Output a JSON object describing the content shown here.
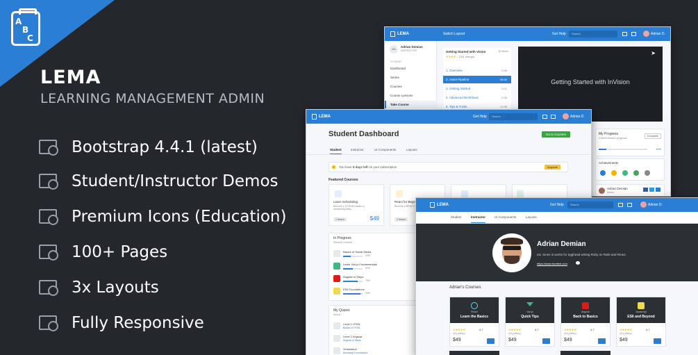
{
  "brand": {
    "logo_letters": [
      "A",
      "B",
      "C"
    ],
    "name": "LEMA",
    "tagline": "LEARNING MANAGEMENT ADMIN"
  },
  "features": [
    {
      "label": "Bootstrap 4.4.1 (latest)",
      "icon": "book-search-icon"
    },
    {
      "label": "Student/Instructor Demos",
      "icon": "book-search-icon"
    },
    {
      "label": "Premium Icons (Education)",
      "icon": "book-search-icon"
    },
    {
      "label": "100+ Pages",
      "icon": "book-search-icon"
    },
    {
      "label": "3x Layouts",
      "icon": "book-search-icon"
    },
    {
      "label": "Fully Responsive",
      "icon": "book-search-icon"
    }
  ],
  "colors": {
    "bg": "#24282d",
    "accent": "#2a7fd4",
    "muted": "#b7bdc4"
  },
  "shot1": {
    "logo": "LEMA",
    "switch_layout": "Switch Layout",
    "get_help": "Get Help",
    "search": "Search",
    "user": "Adrian D.",
    "profile_name": "Adrian Demian",
    "profile_role": "INSTRUCTOR",
    "initials": "AD",
    "section_label": "STUDENT",
    "menu": [
      "Dashboard",
      "Series",
      "Courses",
      "Course Lessons",
      "Take Course"
    ],
    "course_title": "Getting Started with Vision",
    "course_meta": "3h 50min",
    "course_rating": "(2k1 ratings)",
    "lessons": [
      {
        "n": "1. Overview",
        "t": "0:55"
      },
      {
        "n": "2. Asset Pipeline",
        "t": "06:40"
      },
      {
        "n": "3. Getting Started",
        "t": "0:21"
      },
      {
        "n": "4. Advanced Workflows",
        "t": "0:35"
      },
      {
        "n": "5. Tips & Tricks",
        "t": "11:39"
      }
    ],
    "video_title": "Getting Started with InVision",
    "progress_title": "My Progress",
    "progress_sub": "Current lesson progress",
    "progress_value": "15%",
    "progress_fraction": 0.15,
    "complete": "Complete",
    "achievements": "Achievements",
    "author_name": "Adrian Demian",
    "author_role": "Author"
  },
  "shot2": {
    "logo": "LEMA",
    "get_help": "Get Help",
    "search": "Search",
    "user": "Adrian D.",
    "title": "Student Dashboard",
    "go_courses": "Go to Courses",
    "tabs": [
      "Student",
      "Instructor",
      "UI Components",
      "Layouts"
    ],
    "notice_pre": "You have ",
    "notice_bold": "5 days left",
    "notice_post": " on your subscription",
    "upgrade": "Upgrade",
    "featured_title": "Featured Courses",
    "featured": [
      {
        "t": "Learn Scheduling",
        "d": "Become a SCRUM master in scheduling tasks.",
        "b": "1 lesson",
        "p": "$49"
      },
      {
        "t": "React for Beginners",
        "d": "Become a REACT master in no time.",
        "b": "2 lesson",
        "p": ""
      }
    ],
    "progress_title": "In Progress",
    "progress_sub": "Recent Courses",
    "in_progress": [
      {
        "t": "Basics of Social Media",
        "v": "40%",
        "f": 0.4
      },
      {
        "t": "Learn Vue.js Fundamentals",
        "v": "50%",
        "f": 0.5
      },
      {
        "t": "Angular in Steps",
        "v": "75%",
        "f": 0.75
      },
      {
        "t": "ES6 Foundations",
        "v": "90%",
        "f": 0.9
      }
    ],
    "quiz_title": "My Quizes",
    "quiz_sub": "Score",
    "quizzes": [
      {
        "t": "Level 1 HTML",
        "s": "Basics of HTML"
      },
      {
        "t": "Level 2 Angular",
        "s": "Angular in Steps"
      },
      {
        "t": "Graduation",
        "s": "Bootstrap Foundations"
      }
    ]
  },
  "shot3": {
    "logo": "LEMA",
    "get_help": "Get Help",
    "search": "Search",
    "user": "Adrian D.",
    "tabs": [
      "Student",
      "Instructor",
      "UI Components",
      "Layouts"
    ],
    "name": "Adrian Demian",
    "bio": "Ian Jones is works for egghead writing Ruby on Rails and React.",
    "site": "https://www.frontted.com",
    "courses_title": "Adrian's Courses",
    "courses": [
      {
        "cat": "React",
        "t": "Learn the Basics",
        "r": "4.7",
        "rc": "(2k1 ratings)",
        "p": "$49",
        "c": "#61dafb"
      },
      {
        "cat": "Vue.js",
        "t": "Quick Tips",
        "r": "4.7",
        "rc": "(2k1 ratings)",
        "p": "$49",
        "c": "#41b883"
      },
      {
        "cat": "Angular",
        "t": "Back to Basics",
        "r": "4.7",
        "rc": "(2k1 ratings)",
        "p": "$49",
        "c": "#dd1b16"
      },
      {
        "cat": "Javascript",
        "t": "ES6 and Beyond",
        "r": "4.7",
        "rc": "(2k1 ratings)",
        "p": "$49",
        "c": "#f0db4f"
      }
    ]
  }
}
